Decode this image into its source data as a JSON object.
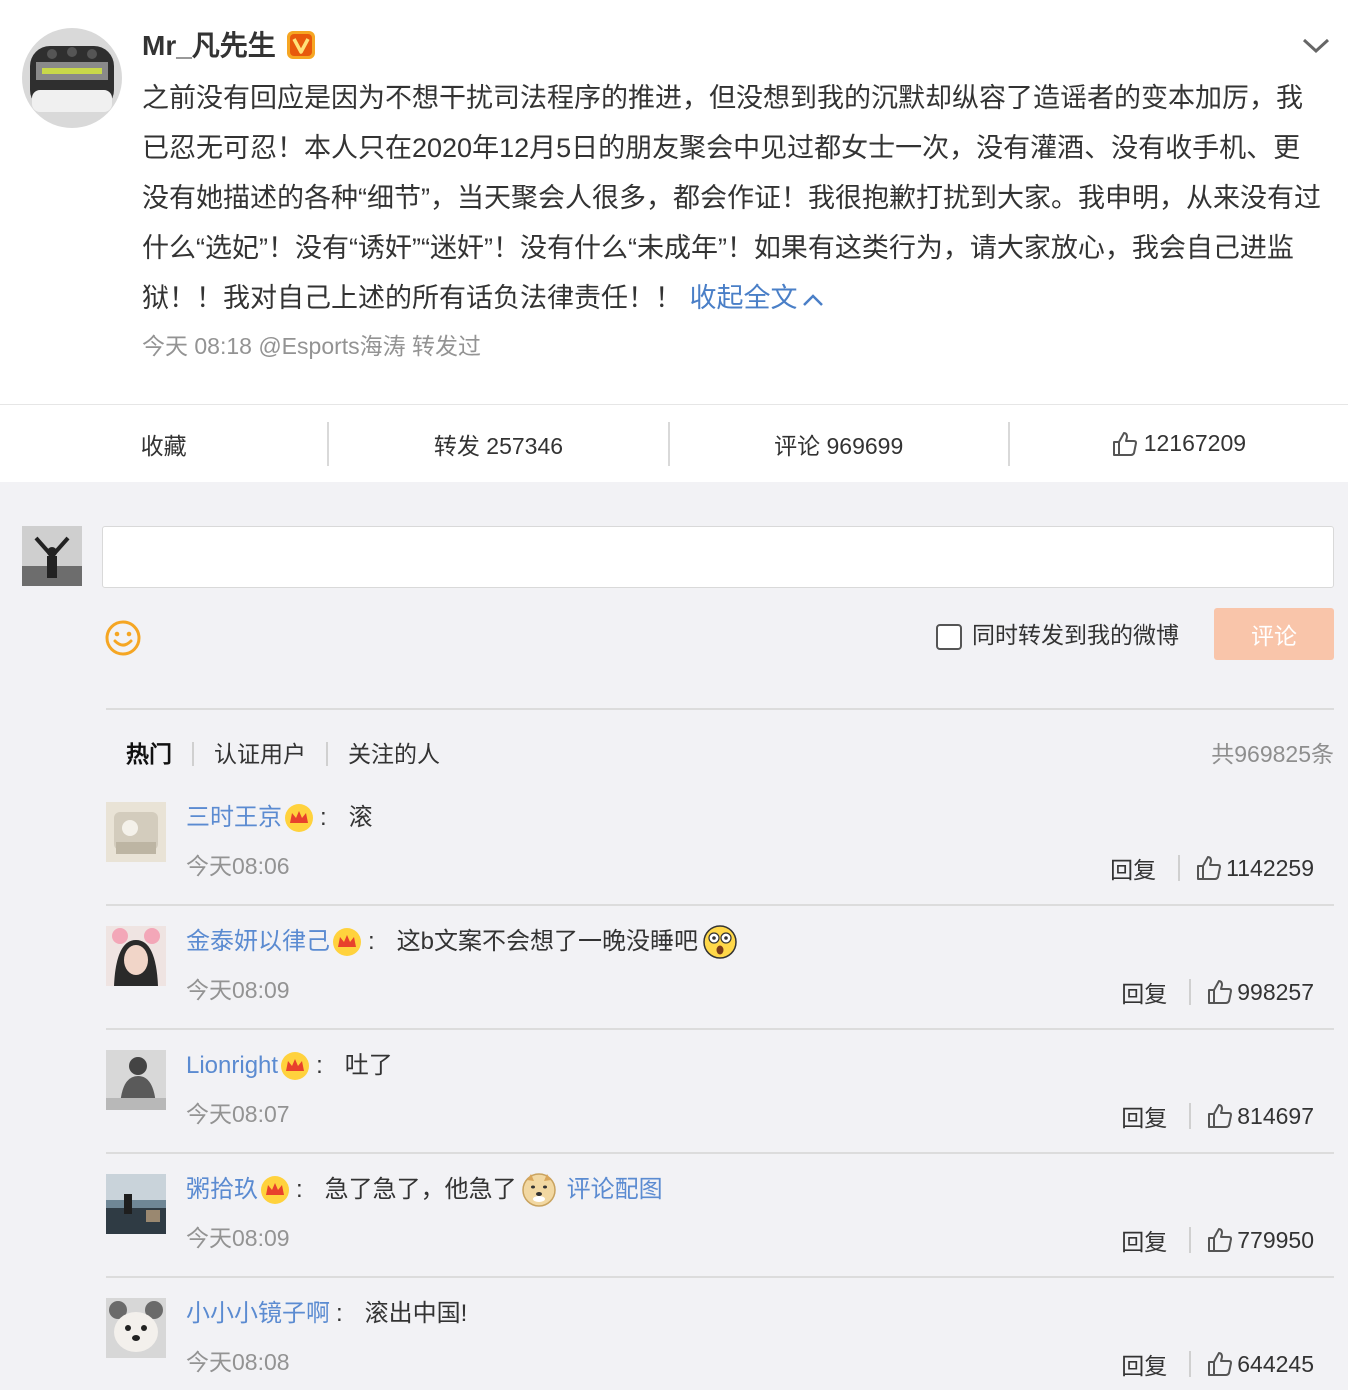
{
  "post": {
    "author": "Mr_凡先生",
    "text": "之前没有回应是因为不想干扰司法程序的推进，但没想到我的沉默却纵容了造谣者的变本加厉，我已忍无可忍！本人只在2020年12月5日的朋友聚会中见过都女士一次，没有灌酒、没有收手机、更没有她描述的各种“细节”，当天聚会人很多，都会作证！我很抱歉打扰到大家。我申明，从来没有过什么“选妃”！没有“诱奸”“迷奸”！没有什么“未成年”！如果有这类行为，请大家放心，我会自己进监狱！！我对自己上述的所有话负法律责任！！",
    "collapse_label": "收起全文",
    "meta": "今天 08:18 @Esports海涛 转发过",
    "actions": {
      "favorite": "收藏",
      "repost": "转发 257346",
      "comment": "评论 969699",
      "likes": "12167209"
    }
  },
  "composer": {
    "repost_label": "同时转发到我的微博",
    "submit_label": "评论"
  },
  "comments_header": {
    "tabs": [
      "热门",
      "认证用户",
      "关注的人"
    ],
    "total": "共969825条"
  },
  "comments": [
    {
      "name": "三时王京",
      "crown": true,
      "text": "滚",
      "time": "今天08:06",
      "reply": "回复",
      "likes": "1142259"
    },
    {
      "name": "金泰妍以律己",
      "crown": true,
      "text": "这b文案不会想了一晚没睡吧",
      "emoji": "shocked-face",
      "time": "今天08:09",
      "reply": "回复",
      "likes": "998257"
    },
    {
      "name": "Lionright",
      "crown": true,
      "text": "吐了",
      "time": "今天08:07",
      "reply": "回复",
      "likes": "814697"
    },
    {
      "name": "粥拾玖",
      "crown": true,
      "text": "急了急了，他急了",
      "emoji": "doge-face",
      "image_link": "评论配图",
      "time": "今天08:09",
      "reply": "回复",
      "likes": "779950"
    },
    {
      "name": "小小小镜子啊",
      "crown": false,
      "text": "滚出中国!",
      "time": "今天08:08",
      "reply": "回复",
      "likes": "644245"
    }
  ],
  "colors": {
    "link": "#5b8bd1",
    "submit_disabled": "#f9c5aa",
    "emoji_icon": "#f5a623"
  }
}
